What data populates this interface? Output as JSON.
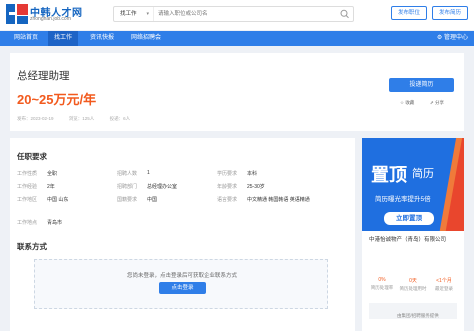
{
  "header": {
    "logo_title": "中韩人才网",
    "logo_sub": "zhonghan.job.com",
    "search_type": "找工作",
    "search_placeholder": "请输入职位或公司名",
    "post_job": "发布职位",
    "post_resume": "发布简历"
  },
  "nav": {
    "items": [
      "网站首页",
      "找工作",
      "资讯快报",
      "网络招聘会"
    ],
    "active_index": 1,
    "admin": "管理中心"
  },
  "job": {
    "title": "总经理助理",
    "salary": "20~25万元/年",
    "meta": [
      "发布：2023-02-19",
      "浏览：125人",
      "投递：6人"
    ],
    "apply": "投递简历",
    "actions": [
      "收藏",
      "分享"
    ]
  },
  "requirements": {
    "title": "任职要求",
    "rows": [
      [
        {
          "label": "工作性质",
          "value": "全职"
        },
        {
          "label": "招聘人数",
          "value": "1"
        },
        {
          "label": "学历要求",
          "value": "本科"
        }
      ],
      [
        {
          "label": "工作经验",
          "value": "2年"
        },
        {
          "label": "招聘部门",
          "value": "总经理办公室"
        },
        {
          "label": "年龄要求",
          "value": "25-30岁"
        }
      ],
      [
        {
          "label": "工作地区",
          "value": "中国 山东"
        },
        {
          "label": "国籍要求",
          "value": "中国"
        },
        {
          "label": "语言要求",
          "value": "中文精通  韩国韩语  英语精通"
        }
      ],
      [
        {
          "label": "工作地点",
          "value": "青岛市"
        }
      ]
    ]
  },
  "contact": {
    "title": "联系方式",
    "message": "您尚未登录，点击登录后可获取企业联系方式",
    "login": "点击登录"
  },
  "sidebar": {
    "banner_big": "置顶",
    "banner_big2": "简历",
    "banner_sub": "简历曝光率提升5倍",
    "banner_btn": "立即置顶",
    "company": "中港怡诚物产（青岛）有限公司",
    "stats": [
      {
        "value": "0%",
        "label": "简历处理率"
      },
      {
        "value": "0天",
        "label": "简历处理用时"
      },
      {
        "value": "<1个月",
        "label": "最近登录"
      }
    ],
    "footer_text": "由集团/招聘服务提供"
  },
  "colors": {
    "primary": "#2f7ee8",
    "salary": "#f25a1e",
    "banner": "#1f6fe0"
  }
}
